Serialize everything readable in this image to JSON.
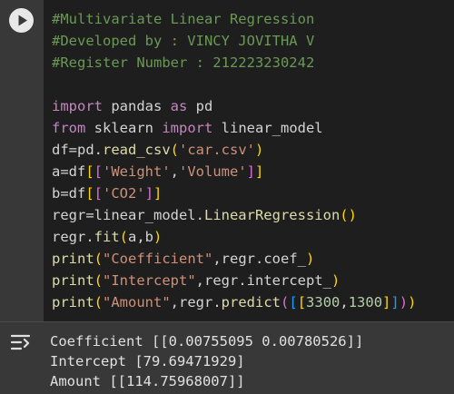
{
  "colors": {
    "cell_bg": "#383838",
    "editor_bg": "#1e1e1e",
    "comment": "#6a9955",
    "keyword": "#c586c0",
    "function": "#dcdcaa",
    "string": "#ce9178",
    "number": "#b5cea8"
  },
  "toolbar": {
    "run_icon": "play-icon",
    "output_icon": "clear-output-icon"
  },
  "code": {
    "l1": "#Multivariate Linear Regression",
    "l2": "#Developed by : VINCY JOVITHA V",
    "l3": "#Register Number : 212223230242",
    "l5_kw1": "import",
    "l5_mid": " pandas ",
    "l5_kw2": "as",
    "l5_end": " pd",
    "l6_kw1": "from",
    "l6_mid": " sklearn ",
    "l6_kw2": "import",
    "l6_end": " linear_model",
    "l7_a": "df=pd.",
    "l7_fn": "read_csv",
    "l7_p1": "(",
    "l7_str": "'car.csv'",
    "l7_p2": ")",
    "l8_a": "a=df",
    "l8_b1": "[",
    "l8_b2": "[",
    "l8_s1": "'Weight'",
    "l8_c": ",",
    "l8_s2": "'Volume'",
    "l8_b3": "]",
    "l8_b4": "]",
    "l9_a": "b=df",
    "l9_b1": "[",
    "l9_b2": "[",
    "l9_s1": "'CO2'",
    "l9_b3": "]",
    "l9_b4": "]",
    "l10_a": "regr=linear_model.",
    "l10_fn": "LinearRegression",
    "l10_p": "()",
    "l11_a": "regr.",
    "l11_fn": "fit",
    "l11_p1": "(",
    "l11_m": "a,b",
    "l11_p2": ")",
    "l12_fn": "print",
    "l12_p1": "(",
    "l12_s": "\"Coefficient\"",
    "l12_m": ",regr.coef_",
    "l12_p2": ")",
    "l13_fn": "print",
    "l13_p1": "(",
    "l13_s": "\"Intercept\"",
    "l13_m": ",regr.intercept_",
    "l13_p2": ")",
    "l14_fn": "print",
    "l14_p1": "(",
    "l14_s": "\"Amount\"",
    "l14_m": ",regr.",
    "l14_fn2": "predict",
    "l14_p3": "(",
    "l14_b1": "[",
    "l14_b2": "[",
    "l14_n1": "3300",
    "l14_c": ",",
    "l14_n2": "1300",
    "l14_b3": "]",
    "l14_b4": "]",
    "l14_p4": ")",
    "l14_p2": ")"
  },
  "output": {
    "o1": "Coefficient [[0.00755095 0.00780526]]",
    "o2": "Intercept [79.69471929]",
    "o3": "Amount [[114.75968007]]"
  }
}
